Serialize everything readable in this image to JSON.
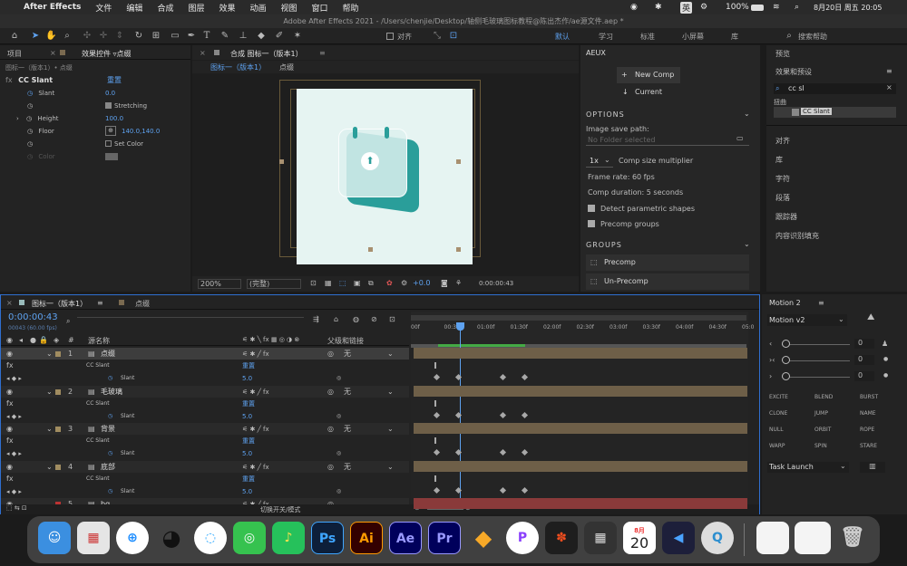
{
  "menubar": {
    "app": "After Effects",
    "items": [
      "文件",
      "编辑",
      "合成",
      "图层",
      "效果",
      "动画",
      "视图",
      "窗口",
      "帮助"
    ],
    "input_method": "英",
    "battery": "100%",
    "datetime": "8月20日 周五 20:05"
  },
  "window": {
    "title": "Adobe After Effects 2021 - /Users/chenjie/Desktop/轴侧毛玻璃图标教程@陈出杰作/ae源文件.aep *"
  },
  "toolbar": {
    "align_label": "对齐",
    "workspaces": [
      "默认",
      "学习",
      "标准",
      "小屏幕",
      "库"
    ],
    "search_placeholder": "搜索帮助"
  },
  "effect_panel": {
    "tab_project": "项目",
    "tab_effects": "效果控件 ▿点缀",
    "breadcrumb": "图标一（版本1）• 点缀",
    "effect_name": "CC Slant",
    "reset": "重置",
    "props": [
      {
        "label": "Slant",
        "value": "0.0"
      },
      {
        "label": "",
        "value": "Stretching"
      },
      {
        "label": "Height",
        "value": "100.0"
      },
      {
        "label": "Floor",
        "value": "140.0,140.0"
      },
      {
        "label": "",
        "value": "Set Color"
      },
      {
        "label": "Color",
        "value": ""
      }
    ]
  },
  "comp_panel": {
    "tab": "合成 图标一（版本1）",
    "crumb_comp": "图标一（版本1）",
    "crumb_layer": "点缀",
    "zoom": "200%",
    "quality": "(完整)",
    "exposure": "+0.0",
    "timecode": "0:00:00:43"
  },
  "aeux": {
    "tab": "AEUX",
    "new_comp": "New Comp",
    "current": "Current",
    "options_title": "OPTIONS",
    "image_save_label": "Image save path:",
    "image_save_placeholder": "No Folder selected",
    "multiplier_value": "1x",
    "multiplier_label": "Comp size multiplier",
    "frame_rate": "Frame rate:  60  fps",
    "comp_duration": "Comp duration:  5  seconds",
    "detect": "Detect parametric shapes",
    "precomp_groups": "Precomp groups",
    "groups_title": "GROUPS",
    "precomp": "Precomp",
    "unprecomp": "Un-Precomp"
  },
  "right_panel": {
    "preview": "预览",
    "effects_presets": "效果和预设",
    "search_value": "cc sl",
    "category": "扭曲",
    "result": "CC Slant",
    "items": [
      "对齐",
      "库",
      "字符",
      "段落",
      "跟踪器",
      "内容识别填充"
    ]
  },
  "timeline": {
    "tab": "图标一（版本1）",
    "tab2": "点缀",
    "timecode": "0:00:00:43",
    "fps": "00043 (60.00 fps)",
    "col_name": "源名称",
    "col_parent": "父级和链接",
    "ticks": [
      "00f",
      "00:30f",
      "01:00f",
      "01:30f",
      "02:00f",
      "02:30f",
      "03:00f",
      "03:30f",
      "04:00f",
      "04:30f",
      "05:0"
    ],
    "layers": [
      {
        "num": "1",
        "name": "点缀",
        "effect": "CC Slant",
        "prop": "Slant",
        "value": "5.0",
        "reset": "重置",
        "parent": "无"
      },
      {
        "num": "2",
        "name": "毛玻璃",
        "effect": "CC Slant",
        "prop": "Slant",
        "value": "5.0",
        "reset": "重置",
        "parent": "无"
      },
      {
        "num": "3",
        "name": "背景",
        "effect": "CC Slant",
        "prop": "Slant",
        "value": "5.0",
        "reset": "重置",
        "parent": "无"
      },
      {
        "num": "4",
        "name": "底部",
        "effect": "CC Slant",
        "prop": "Slant",
        "value": "5.0",
        "reset": "重置",
        "parent": "无"
      },
      {
        "num": "5",
        "name": "bg",
        "effect": "",
        "prop": "",
        "value": "",
        "reset": "",
        "parent": ""
      }
    ],
    "footer": "切换开关/模式"
  },
  "motion2": {
    "title": "Motion 2",
    "version": "Motion v2",
    "values": [
      "0",
      "0",
      "0"
    ],
    "actions": [
      "EXCITE",
      "BLEND",
      "BURST",
      "CLONE",
      "JUMP",
      "NAME",
      "NULL",
      "ORBIT",
      "ROPE",
      "WARP",
      "SPIN",
      "STARE"
    ],
    "task": "Task Launch"
  },
  "dock": {
    "calendar_month": "8月",
    "calendar_day": "20",
    "apps": [
      {
        "label": "Ps",
        "color": "#0d1f3a",
        "fg": "#3fa6ff"
      },
      {
        "label": "Ai",
        "color": "#330000",
        "fg": "#ff9a00"
      },
      {
        "label": "Ae",
        "color": "#00005b",
        "fg": "#9999ff"
      },
      {
        "label": "Pr",
        "color": "#00005b",
        "fg": "#9999ff"
      }
    ]
  }
}
